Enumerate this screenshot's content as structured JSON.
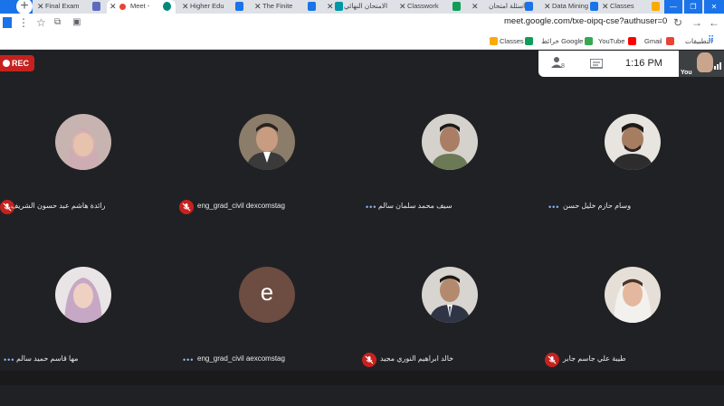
{
  "browser": {
    "tabs": [
      {
        "label": "Final Exam"
      },
      {
        "label": "Meet -"
      },
      {
        "label": "Higher Edu"
      },
      {
        "label": "The Finite"
      },
      {
        "label": "الامتحان النهائي"
      },
      {
        "label": "Classwork"
      },
      {
        "label": "اسئلة امتحان"
      },
      {
        "label": "Data Mining"
      },
      {
        "label": "Classes"
      }
    ],
    "url": "meet.google.com/txe-oipq-cse?authuser=0",
    "bookmarks": [
      "التطبيقات",
      "Gmail",
      "YouTube",
      "خرائط Google",
      "Classes"
    ]
  },
  "meeting": {
    "rec_label": "REC",
    "time": "1:16 PM",
    "self_label": "You",
    "participants": [
      {
        "name": "رائدة هاشم عبد حسون الشريف",
        "audio": "muted"
      },
      {
        "name": "eng_grad_civil dexcomstag",
        "audio": "muted"
      },
      {
        "name": "سيف محمد سلمان سالم",
        "audio": "speaking"
      },
      {
        "name": "وسام حازم خليل حسن",
        "audio": "speaking"
      },
      {
        "name": "مها قاسم حميد سالم",
        "audio": "speaking"
      },
      {
        "name": "eng_grad_civil aexcomstag",
        "audio": "speaking",
        "initial": "e"
      },
      {
        "name": "خالد ابراهيم النوري مجيد",
        "audio": "muted"
      },
      {
        "name": "طيبة علي جاسم جابر",
        "audio": "muted"
      }
    ]
  },
  "colors": {
    "accent": "#1a73e8",
    "rec": "#c5221f",
    "background": "#202124",
    "avatar_e": "#6d4c41"
  }
}
